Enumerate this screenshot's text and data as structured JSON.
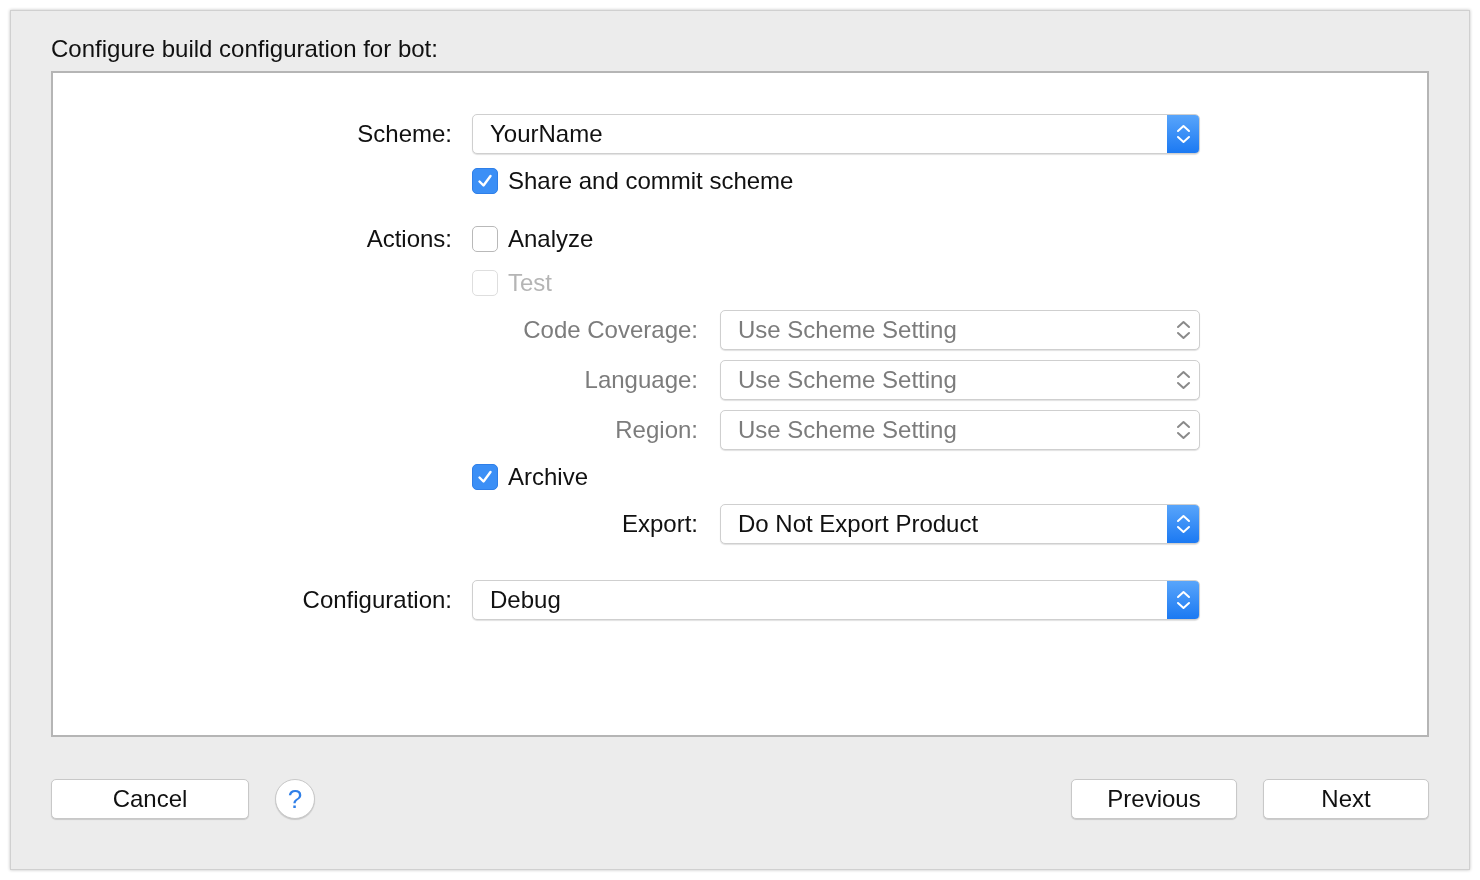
{
  "title": "Configure build configuration for bot:",
  "rows": [
    {
      "kind": "popup",
      "label": "Scheme:",
      "value": "YourName",
      "disabled": false
    },
    {
      "kind": "checkbox",
      "text": "Share and commit scheme",
      "checked": true,
      "disabled": false
    },
    {
      "kind": "checkbox",
      "label": "Actions:",
      "text": "Analyze",
      "checked": false,
      "disabled": false
    },
    {
      "kind": "checkbox",
      "text": "Test",
      "checked": false,
      "disabled": true,
      "children": [
        {
          "kind": "popup",
          "label": "Code Coverage:",
          "value": "Use Scheme Setting",
          "disabled": true
        },
        {
          "kind": "popup",
          "label": "Language:",
          "value": "Use Scheme Setting",
          "disabled": true
        },
        {
          "kind": "popup",
          "label": "Region:",
          "value": "Use Scheme Setting",
          "disabled": true
        }
      ]
    },
    {
      "kind": "checkbox",
      "text": "Archive",
      "checked": true,
      "disabled": false,
      "children": [
        {
          "kind": "popup",
          "label": "Export:",
          "value": "Do Not Export Product",
          "disabled": false
        }
      ]
    },
    {
      "kind": "popup",
      "label": "Configuration:",
      "value": "Debug",
      "disabled": false
    }
  ],
  "footer": {
    "left": [
      {
        "kind": "push",
        "label": "Cancel"
      },
      {
        "kind": "help",
        "label": "?"
      }
    ],
    "right": [
      {
        "kind": "push",
        "label": "Previous"
      },
      {
        "kind": "push",
        "label": "Next"
      }
    ]
  }
}
